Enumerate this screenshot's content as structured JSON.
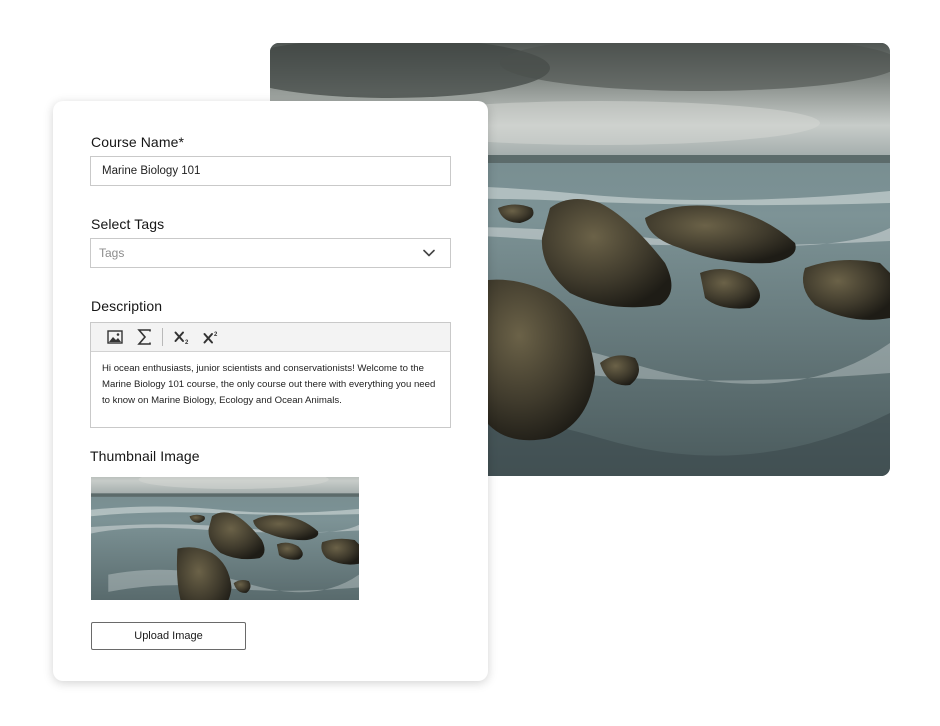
{
  "form": {
    "course_name": {
      "label": "Course Name*",
      "value": "Marine Biology 101"
    },
    "tags": {
      "label": "Select Tags",
      "placeholder": "Tags",
      "icon": "chevron-down-icon"
    },
    "description": {
      "label": "Description",
      "toolbar": [
        {
          "name": "insert-image-icon",
          "title": "Image"
        },
        {
          "name": "sigma-icon",
          "title": "Equation"
        },
        {
          "name": "subscript-icon",
          "title": "Subscript"
        },
        {
          "name": "superscript-icon",
          "title": "Superscript"
        }
      ],
      "text": "Hi ocean enthusiasts, junior scientists and conservationists! Welcome to the Marine Biology 101 course, the only course out there with everything you need to know on Marine Biology, Ecology and Ocean Animals."
    },
    "thumbnail": {
      "label": "Thumbnail Image",
      "upload_label": "Upload Image"
    }
  },
  "colors": {
    "border": "#c9c9c9",
    "toolbar_bg": "#f3f3f3",
    "text": "#1c1c1c"
  }
}
